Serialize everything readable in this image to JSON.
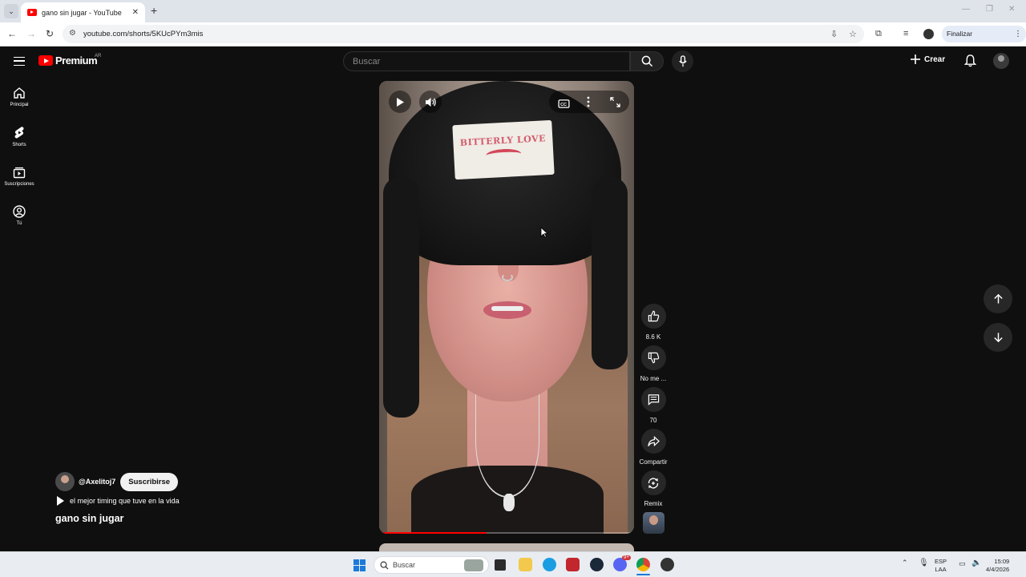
{
  "browser": {
    "tab_title": "gano sin jugar - YouTube",
    "url": "youtube.com/shorts/5KUcPYm3mis",
    "update_label": "Finalizar actualización"
  },
  "header": {
    "logo_text": "Premium",
    "region": "AR",
    "search_placeholder": "Buscar",
    "create_label": "Crear"
  },
  "sidebar": {
    "items": [
      {
        "label": "Principal",
        "icon": "home-icon"
      },
      {
        "label": "Shorts",
        "icon": "shorts-icon"
      },
      {
        "label": "Suscripciones",
        "icon": "subscriptions-icon"
      },
      {
        "label": "Tú",
        "icon": "you-icon"
      }
    ]
  },
  "video": {
    "patch_text": "BITTERLY LOVE",
    "progress_fraction": 0.42
  },
  "actions": {
    "like_count": "8.6 K",
    "dislike_label": "No me ...",
    "comment_count": "70",
    "share_label": "Compartir",
    "remix_label": "Remix"
  },
  "short": {
    "channel_handle": "@Axelitoj7",
    "subscribe_label": "Suscribirse",
    "description": "el mejor timing que tuve en la vida",
    "title": "gano sin jugar"
  },
  "taskbar": {
    "search_label": "Buscar",
    "lang_top": "ESP",
    "lang_bottom": "LAA",
    "time": "15:09",
    "date": "4/4/2026",
    "discord_badge": "9+"
  },
  "colors": {
    "accent": "#ff0000",
    "bg": "#0f0f0f"
  }
}
